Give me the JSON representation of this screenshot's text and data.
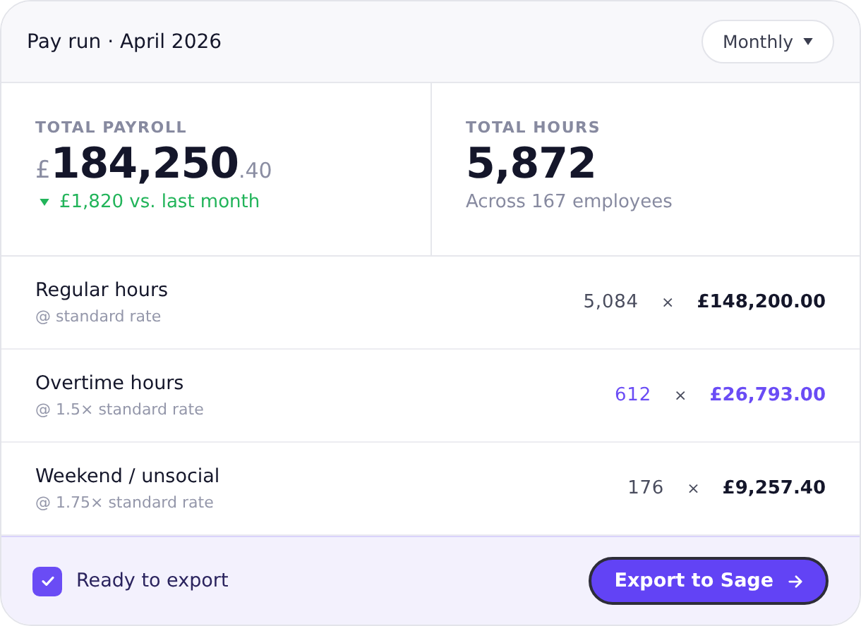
{
  "header": {
    "title": "Pay run · April 2026",
    "period_dropdown": "Monthly"
  },
  "stats": [
    {
      "kind": "money",
      "label": "TOTAL PAYROLL",
      "currency": "£",
      "whole": "184,250",
      "fraction": ".40",
      "change": "£1,820 vs. last month"
    },
    {
      "kind": "plain",
      "label": "TOTAL HOURS",
      "value": "5,872",
      "note": "Across 167 employees"
    }
  ],
  "rows": [
    {
      "name": "Regular hours",
      "rate": "@ standard rate",
      "hours": "5,084",
      "times": "×",
      "amount": "£148,200.00",
      "highlighted": false
    },
    {
      "name": "Overtime hours",
      "rate": "@ 1.5× standard rate",
      "hours": "612",
      "times": "×",
      "amount": "£26,793.00",
      "highlighted": true
    },
    {
      "name": "Weekend / unsocial",
      "rate": "@ 1.75× standard rate",
      "hours": "176",
      "times": "×",
      "amount": "£9,257.40",
      "highlighted": false
    }
  ],
  "footer": {
    "checkbox": {
      "label": "Ready to export",
      "checked": true
    },
    "button": "Export to Sage"
  }
}
